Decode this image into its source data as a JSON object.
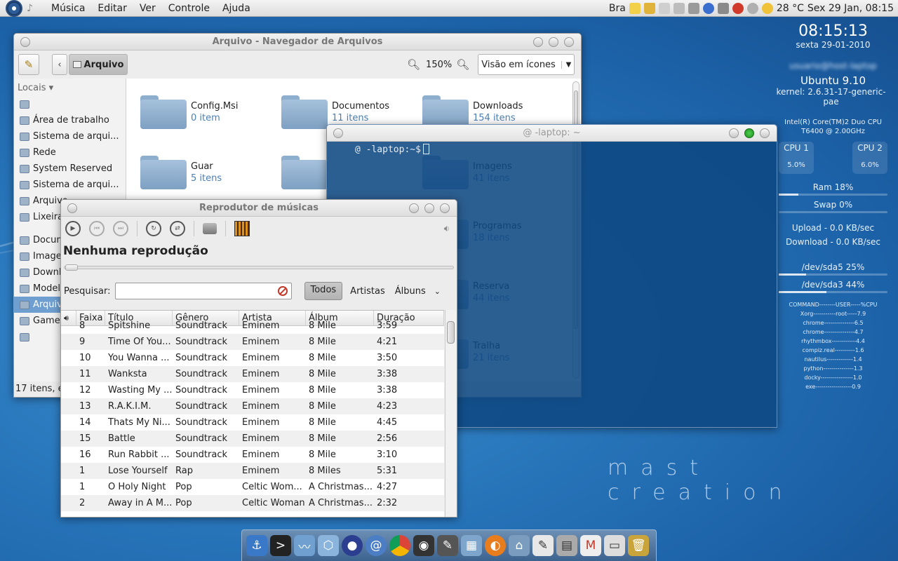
{
  "top_panel": {
    "menus": [
      "Música",
      "Editar",
      "Ver",
      "Controle",
      "Ajuda"
    ],
    "keyboard_layout": "Bra",
    "weather": "28 °C",
    "datetime": "Sex 29 Jan, 08:15"
  },
  "conky": {
    "clock": "08:15:13",
    "date": "sexta 29-01-2010",
    "os": "Ubuntu 9.10",
    "kernel": "kernel: 2.6.31-17-generic-pae",
    "cpu_name_1": "Intel(R) Core(TM)2 Duo CPU",
    "cpu_name_2": "T6400  @ 2.00GHz",
    "cpu1_label": "CPU 1",
    "cpu1_value": "5.0%",
    "cpu2_label": "CPU 2",
    "cpu2_value": "6.0%",
    "ram": "Ram 18%",
    "ram_fraction": 0.18,
    "swap": "Swap 0%",
    "swap_fraction": 0.0,
    "upload": "Upload - 0.0 KB/sec",
    "download": "Download - 0.0 KB/sec",
    "disk1": "/dev/sda5 25%",
    "disk1_fraction": 0.25,
    "disk2": "/dev/sda3 44%",
    "disk2_fraction": 0.44,
    "processes": [
      "COMMAND--------USER-----%CPU",
      "Xorg-----------root-----7.9",
      "chrome---------------6.5",
      "chrome---------------4.7",
      "rhythmbox------------4.4",
      "compiz.real----------1.6",
      "nautilus-------------1.4",
      "python---------------1.3",
      "docky----------------1.0",
      "exe------------------0.9"
    ]
  },
  "watermark": "mast creation",
  "file_manager": {
    "title": "Arquivo - Navegador de Arquivos",
    "location_button": "Arquivo",
    "zoom": "150%",
    "view_mode": "Visão em ícones",
    "sidebar_header": "Locais",
    "sidebar": [
      "",
      "Área de trabalho",
      "Sistema de arqui...",
      "Rede",
      "System Reserved",
      "Sistema de arqui...",
      "Arquivo",
      "Lixeira",
      "",
      "Docum",
      "Image",
      "Downl",
      "Model",
      "Arquiv",
      "Game",
      ""
    ],
    "folders": [
      {
        "name": "Config.Msi",
        "count": "0 item"
      },
      {
        "name": "Documentos",
        "count": "11 itens"
      },
      {
        "name": "Downloads",
        "count": "154 itens"
      },
      {
        "name": "Guar",
        "count": "5 itens"
      },
      {
        "name": "Imagens",
        "count": "41 itens"
      },
      {
        "name": "Programas",
        "count": "18 itens"
      },
      {
        "name": "Reserva",
        "count": "44 itens"
      },
      {
        "name": "Tralha",
        "count": "21 itens"
      }
    ],
    "status": "17 itens, e"
  },
  "terminal": {
    "title": "@      -laptop: ~",
    "prompt": "@      -laptop:~$"
  },
  "music_player": {
    "title": "Reprodutor de músicas",
    "now_playing": "Nenhuma reprodução",
    "search_label": "Pesquisar:",
    "search_value": "",
    "filters": [
      "Todos",
      "Artistas",
      "Álbuns"
    ],
    "columns": [
      "Faixa",
      "Título",
      "Gênero",
      "Artista",
      "Álbum",
      "Duração"
    ],
    "tracks": [
      [
        "8",
        "Spitshine",
        "Soundtrack",
        "Eminem",
        "8 Mile",
        "3:59"
      ],
      [
        "9",
        "Time Of You...",
        "Soundtrack",
        "Eminem",
        "8 Mile",
        "4:21"
      ],
      [
        "10",
        "You Wanna ...",
        "Soundtrack",
        "Eminem",
        "8 Mile",
        "3:50"
      ],
      [
        "11",
        "Wanksta",
        "Soundtrack",
        "Eminem",
        "8 Mile",
        "3:38"
      ],
      [
        "12",
        "Wasting My ...",
        "Soundtrack",
        "Eminem",
        "8 Mile",
        "3:38"
      ],
      [
        "13",
        "R.A.K.I.M.",
        "Soundtrack",
        "Eminem",
        "8 Mile",
        "4:23"
      ],
      [
        "14",
        "Thats My Ni...",
        "Soundtrack",
        "Eminem",
        "8 Mile",
        "4:45"
      ],
      [
        "15",
        "Battle",
        "Soundtrack",
        "Eminem",
        "8 Mile",
        "2:56"
      ],
      [
        "16",
        "Run Rabbit ...",
        "Soundtrack",
        "Eminem",
        "8 Mile",
        "3:10"
      ],
      [
        "1",
        "Lose Yourself",
        "Rap",
        "Eminem",
        "8 Miles",
        "5:31"
      ],
      [
        "1",
        "O Holy Night",
        "Pop",
        "Celtic Wom...",
        "A Christmas...",
        "4:27"
      ],
      [
        "2",
        "Away in A M...",
        "Pop",
        "Celtic Woman",
        "A Christmas...",
        "2:32"
      ]
    ]
  }
}
